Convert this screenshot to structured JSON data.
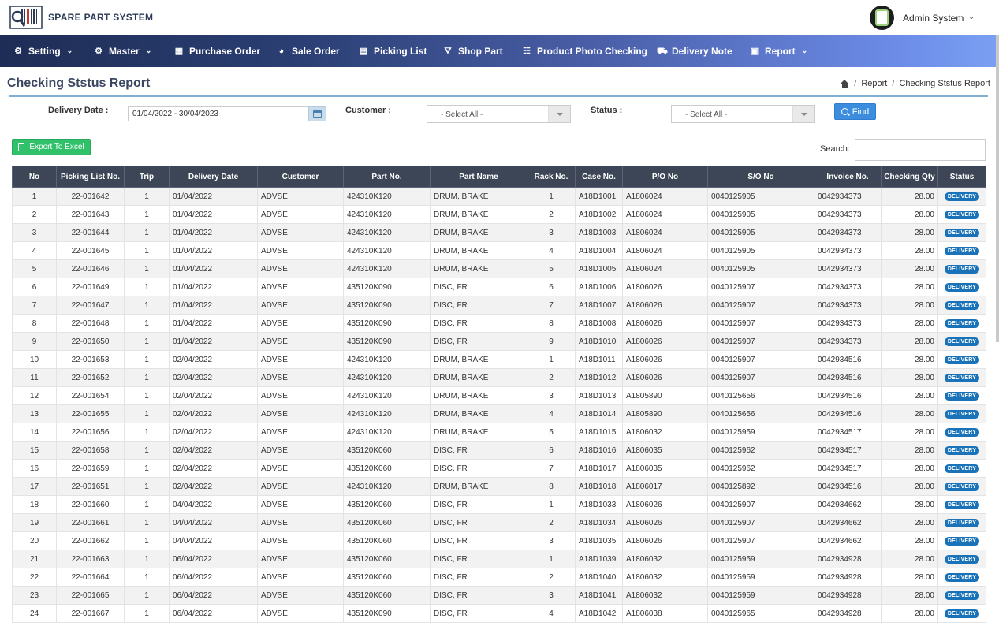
{
  "app": {
    "brand": "SPARE PART SYSTEM"
  },
  "user": {
    "name": "Admin System"
  },
  "nav": {
    "setting": "Setting",
    "master": "Master",
    "purchase_order": "Purchase Order",
    "sale_order": "Sale Order",
    "picking_list": "Picking List",
    "shop_part": "Shop Part",
    "product_photo_checking": "Product Photo Checking",
    "delivery_note": "Delivery Note",
    "report": "Report"
  },
  "page": {
    "title": "Checking Ststus Report",
    "breadcrumb": {
      "report": "Report",
      "current": "Checking Ststus Report"
    }
  },
  "filters": {
    "delivery_date_label": "Delivery Date :",
    "delivery_date_value": "01/04/2022 - 30/04/2023",
    "customer_label": "Customer :",
    "customer_value": "- Select All -",
    "status_label": "Status :",
    "status_value": "- Select All -",
    "find_label": "Find"
  },
  "toolbar": {
    "export_label": "Export To Excel",
    "search_label": "Search:"
  },
  "table": {
    "headers": [
      "No",
      "Picking List No.",
      "Trip",
      "Delivery Date",
      "Customer",
      "Part No.",
      "Part Name",
      "Rack No.",
      "Case No.",
      "P/O No",
      "S/O No",
      "Invoice No.",
      "Checking Qty",
      "Status"
    ],
    "rows": [
      [
        "1",
        "22-001642",
        "1",
        "01/04/2022",
        "ADVSE",
        "424310K120",
        "DRUM, BRAKE",
        "1",
        "A18D1001",
        "A1806024",
        "0040125905",
        "0042934373",
        "28.00",
        "DELIVERY"
      ],
      [
        "2",
        "22-001643",
        "1",
        "01/04/2022",
        "ADVSE",
        "424310K120",
        "DRUM, BRAKE",
        "2",
        "A18D1002",
        "A1806024",
        "0040125905",
        "0042934373",
        "28.00",
        "DELIVERY"
      ],
      [
        "3",
        "22-001644",
        "1",
        "01/04/2022",
        "ADVSE",
        "424310K120",
        "DRUM, BRAKE",
        "3",
        "A18D1003",
        "A1806024",
        "0040125905",
        "0042934373",
        "28.00",
        "DELIVERY"
      ],
      [
        "4",
        "22-001645",
        "1",
        "01/04/2022",
        "ADVSE",
        "424310K120",
        "DRUM, BRAKE",
        "4",
        "A18D1004",
        "A1806024",
        "0040125905",
        "0042934373",
        "28.00",
        "DELIVERY"
      ],
      [
        "5",
        "22-001646",
        "1",
        "01/04/2022",
        "ADVSE",
        "424310K120",
        "DRUM, BRAKE",
        "5",
        "A18D1005",
        "A1806024",
        "0040125905",
        "0042934373",
        "28.00",
        "DELIVERY"
      ],
      [
        "6",
        "22-001649",
        "1",
        "01/04/2022",
        "ADVSE",
        "435120K090",
        "DISC, FR",
        "6",
        "A18D1006",
        "A1806026",
        "0040125907",
        "0042934373",
        "28.00",
        "DELIVERY"
      ],
      [
        "7",
        "22-001647",
        "1",
        "01/04/2022",
        "ADVSE",
        "435120K090",
        "DISC, FR",
        "7",
        "A18D1007",
        "A1806026",
        "0040125907",
        "0042934373",
        "28.00",
        "DELIVERY"
      ],
      [
        "8",
        "22-001648",
        "1",
        "01/04/2022",
        "ADVSE",
        "435120K090",
        "DISC, FR",
        "8",
        "A18D1008",
        "A1806026",
        "0040125907",
        "0042934373",
        "28.00",
        "DELIVERY"
      ],
      [
        "9",
        "22-001650",
        "1",
        "01/04/2022",
        "ADVSE",
        "435120K090",
        "DISC, FR",
        "9",
        "A18D1010",
        "A1806026",
        "0040125907",
        "0042934373",
        "28.00",
        "DELIVERY"
      ],
      [
        "10",
        "22-001653",
        "1",
        "02/04/2022",
        "ADVSE",
        "424310K120",
        "DRUM, BRAKE",
        "1",
        "A18D1011",
        "A1806026",
        "0040125907",
        "0042934516",
        "28.00",
        "DELIVERY"
      ],
      [
        "11",
        "22-001652",
        "1",
        "02/04/2022",
        "ADVSE",
        "424310K120",
        "DRUM, BRAKE",
        "2",
        "A18D1012",
        "A1806026",
        "0040125907",
        "0042934516",
        "28.00",
        "DELIVERY"
      ],
      [
        "12",
        "22-001654",
        "1",
        "02/04/2022",
        "ADVSE",
        "424310K120",
        "DRUM, BRAKE",
        "3",
        "A18D1013",
        "A1805890",
        "0040125656",
        "0042934516",
        "28.00",
        "DELIVERY"
      ],
      [
        "13",
        "22-001655",
        "1",
        "02/04/2022",
        "ADVSE",
        "424310K120",
        "DRUM, BRAKE",
        "4",
        "A18D1014",
        "A1805890",
        "0040125656",
        "0042934516",
        "28.00",
        "DELIVERY"
      ],
      [
        "14",
        "22-001656",
        "1",
        "02/04/2022",
        "ADVSE",
        "424310K120",
        "DRUM, BRAKE",
        "5",
        "A18D1015",
        "A1806032",
        "0040125959",
        "0042934517",
        "28.00",
        "DELIVERY"
      ],
      [
        "15",
        "22-001658",
        "1",
        "02/04/2022",
        "ADVSE",
        "435120K060",
        "DISC, FR",
        "6",
        "A18D1016",
        "A1806035",
        "0040125962",
        "0042934517",
        "28.00",
        "DELIVERY"
      ],
      [
        "16",
        "22-001659",
        "1",
        "02/04/2022",
        "ADVSE",
        "435120K060",
        "DISC, FR",
        "7",
        "A18D1017",
        "A1806035",
        "0040125962",
        "0042934517",
        "28.00",
        "DELIVERY"
      ],
      [
        "17",
        "22-001651",
        "1",
        "02/04/2022",
        "ADVSE",
        "424310K120",
        "DRUM, BRAKE",
        "8",
        "A18D1018",
        "A1806017",
        "0040125892",
        "0042934516",
        "28.00",
        "DELIVERY"
      ],
      [
        "18",
        "22-001660",
        "1",
        "04/04/2022",
        "ADVSE",
        "435120K060",
        "DISC, FR",
        "1",
        "A18D1033",
        "A1806026",
        "0040125907",
        "0042934662",
        "28.00",
        "DELIVERY"
      ],
      [
        "19",
        "22-001661",
        "1",
        "04/04/2022",
        "ADVSE",
        "435120K060",
        "DISC, FR",
        "2",
        "A18D1034",
        "A1806026",
        "0040125907",
        "0042934662",
        "28.00",
        "DELIVERY"
      ],
      [
        "20",
        "22-001662",
        "1",
        "04/04/2022",
        "ADVSE",
        "435120K060",
        "DISC, FR",
        "3",
        "A18D1035",
        "A1806026",
        "0040125907",
        "0042934662",
        "28.00",
        "DELIVERY"
      ],
      [
        "21",
        "22-001663",
        "1",
        "06/04/2022",
        "ADVSE",
        "435120K060",
        "DISC, FR",
        "1",
        "A18D1039",
        "A1806032",
        "0040125959",
        "0042934928",
        "28.00",
        "DELIVERY"
      ],
      [
        "22",
        "22-001664",
        "1",
        "06/04/2022",
        "ADVSE",
        "435120K060",
        "DISC, FR",
        "2",
        "A18D1040",
        "A1806032",
        "0040125959",
        "0042934928",
        "28.00",
        "DELIVERY"
      ],
      [
        "23",
        "22-001665",
        "1",
        "06/04/2022",
        "ADVSE",
        "435120K060",
        "DISC, FR",
        "3",
        "A18D1041",
        "A1806032",
        "0040125959",
        "0042934928",
        "28.00",
        "DELIVERY"
      ],
      [
        "24",
        "22-001667",
        "1",
        "06/04/2022",
        "ADVSE",
        "435120K090",
        "DISC, FR",
        "4",
        "A18D1042",
        "A1806038",
        "0040125965",
        "0042934928",
        "28.00",
        "DELIVERY"
      ]
    ]
  }
}
